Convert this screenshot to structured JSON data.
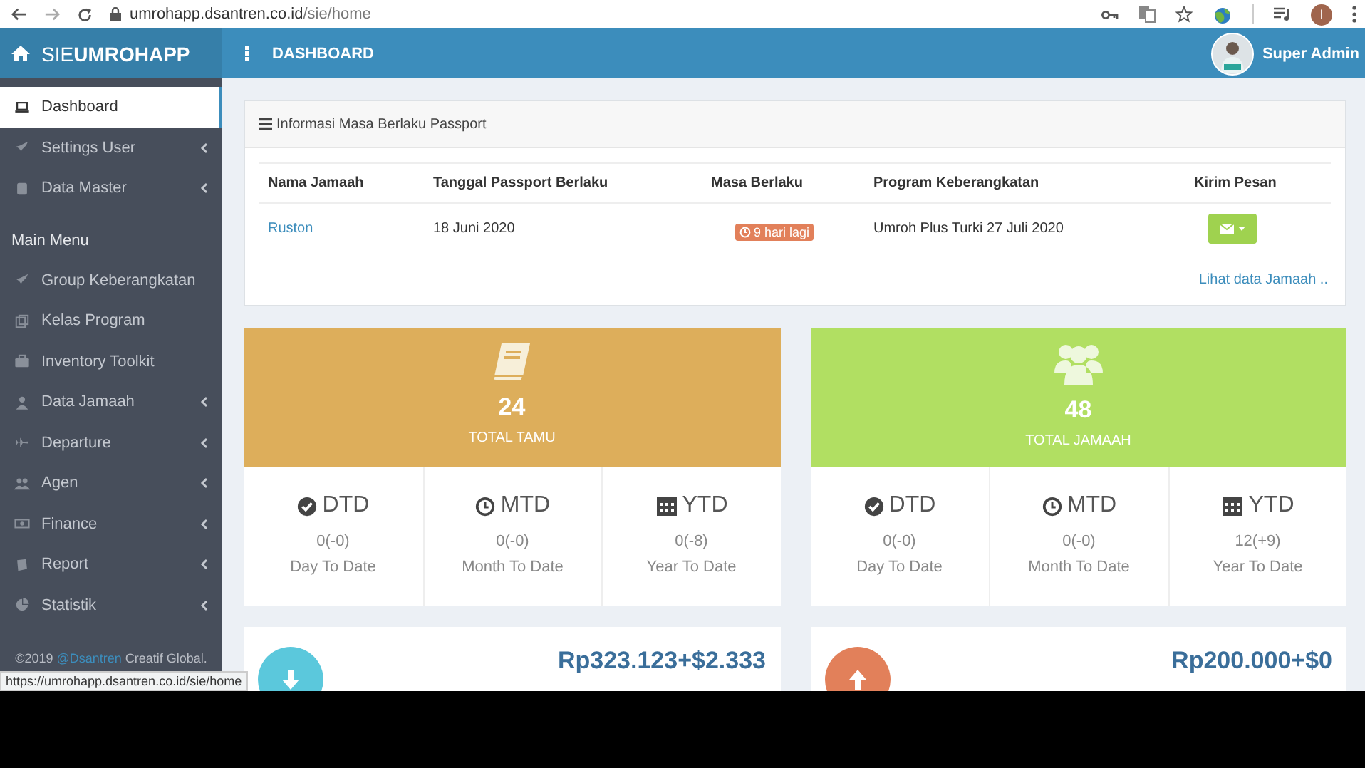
{
  "browser": {
    "url_host": "umrohapp.dsantren.co.id",
    "url_path": "/sie/home",
    "profile_initial": "I"
  },
  "header": {
    "brand": "SIE**UMROHAPP**",
    "title": "DASHBOARD",
    "user": "Super Admin"
  },
  "sidebar": {
    "items": [
      {
        "label": "Dashboard",
        "selected": true,
        "has_submenu": false
      },
      {
        "label": "Settings User",
        "selected": false,
        "has_submenu": true
      },
      {
        "label": "Data Master",
        "selected": false,
        "has_submenu": true
      }
    ],
    "section": "Main Menu",
    "main_items": [
      {
        "label": "Group Keberangkatan",
        "selected": false,
        "has_submenu": false
      },
      {
        "label": "Kelas Program",
        "selected": false,
        "has_submenu": false
      },
      {
        "label": "Inventory Toolkit",
        "selected": false,
        "has_submenu": false
      },
      {
        "label": "Data Jamaah",
        "selected": false,
        "has_submenu": true
      },
      {
        "label": "Departure",
        "selected": false,
        "has_submenu": true
      },
      {
        "label": "Agen",
        "selected": false,
        "has_submenu": true
      },
      {
        "label": "Finance",
        "selected": false,
        "has_submenu": true
      },
      {
        "label": "Report",
        "selected": false,
        "has_submenu": true
      },
      {
        "label": "Statistik",
        "selected": false,
        "has_submenu": true
      }
    ],
    "footer": {
      "prefix": "©2019",
      "link": "@Dsantren",
      "suffix": "Creatif Global."
    }
  },
  "passport_panel": {
    "title": "Informasi Masa Berlaku Passport",
    "columns": [
      "Nama Jamaah",
      "Tanggal Passport Berlaku",
      "Masa Berlaku",
      "Program Keberangkatan",
      "Kirim Pesan"
    ],
    "rows": [
      {
        "name": "Ruston",
        "date": "18 Juni 2020",
        "remaining": "9 hari lagi",
        "program": "Umroh Plus Turki 27 Juli 2020"
      }
    ],
    "link": "Lihat data Jamaah .."
  },
  "stats": [
    {
      "value": "24",
      "label": "TOTAL TAMU",
      "color": "#ddae5b",
      "cells": [
        {
          "title": "DTD",
          "value": "0(-0)",
          "caption": "Day To Date"
        },
        {
          "title": "MTD",
          "value": "0(-0)",
          "caption": "Month To Date"
        },
        {
          "title": "YTD",
          "value": "0(-8)",
          "caption": "Year To Date"
        }
      ]
    },
    {
      "value": "48",
      "label": "TOTAL JAMAAH",
      "color": "#b1df62",
      "cells": [
        {
          "title": "DTD",
          "value": "0(-0)",
          "caption": "Day To Date"
        },
        {
          "title": "MTD",
          "value": "0(-0)",
          "caption": "Month To Date"
        },
        {
          "title": "YTD",
          "value": "12(+9)",
          "caption": "Year To Date"
        }
      ]
    }
  ],
  "finance": [
    {
      "amount": "Rp323.123+$2.333",
      "color": "#5bc8dc"
    },
    {
      "amount": "Rp200.000+$0",
      "color": "#e2805a"
    }
  ],
  "status_tooltip": "https://umrohapp.dsantren.co.id/sie/home"
}
